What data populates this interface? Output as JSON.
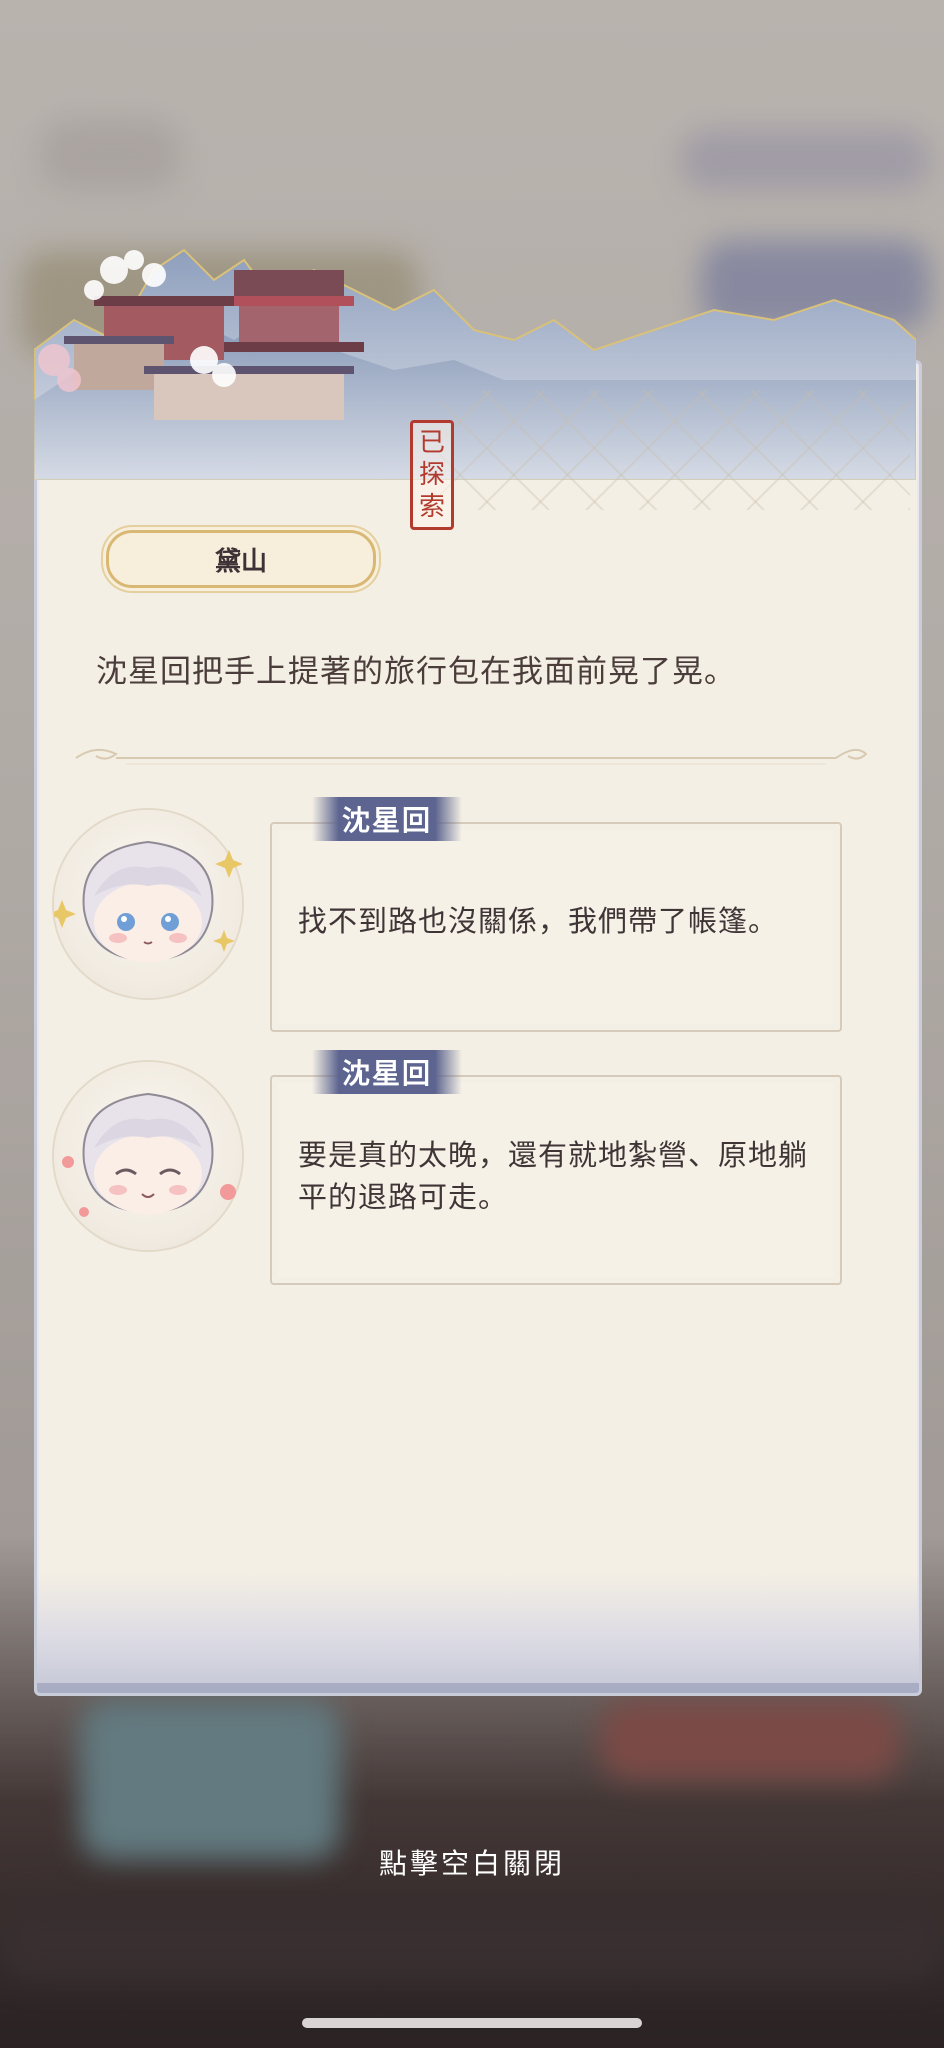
{
  "location": {
    "name": "黛山",
    "status_stamp": [
      "已",
      "探",
      "索"
    ]
  },
  "narration": "沈星回把手上提著的旅行包在我面前晃了晃。",
  "dialogues": [
    {
      "speaker": "沈星回",
      "text": "找不到路也沒關係，我們帶了帳篷。"
    },
    {
      "speaker": "沈星回",
      "text": "要是真的太晚，還有就地紮營、原地躺平的退路可走。"
    }
  ],
  "close_hint": "點擊空白關閉",
  "colors": {
    "panel": "#f4efe4",
    "speaker_tag": "#5c648f",
    "stamp": "#b23b2e",
    "title_border": "#d9b874"
  }
}
